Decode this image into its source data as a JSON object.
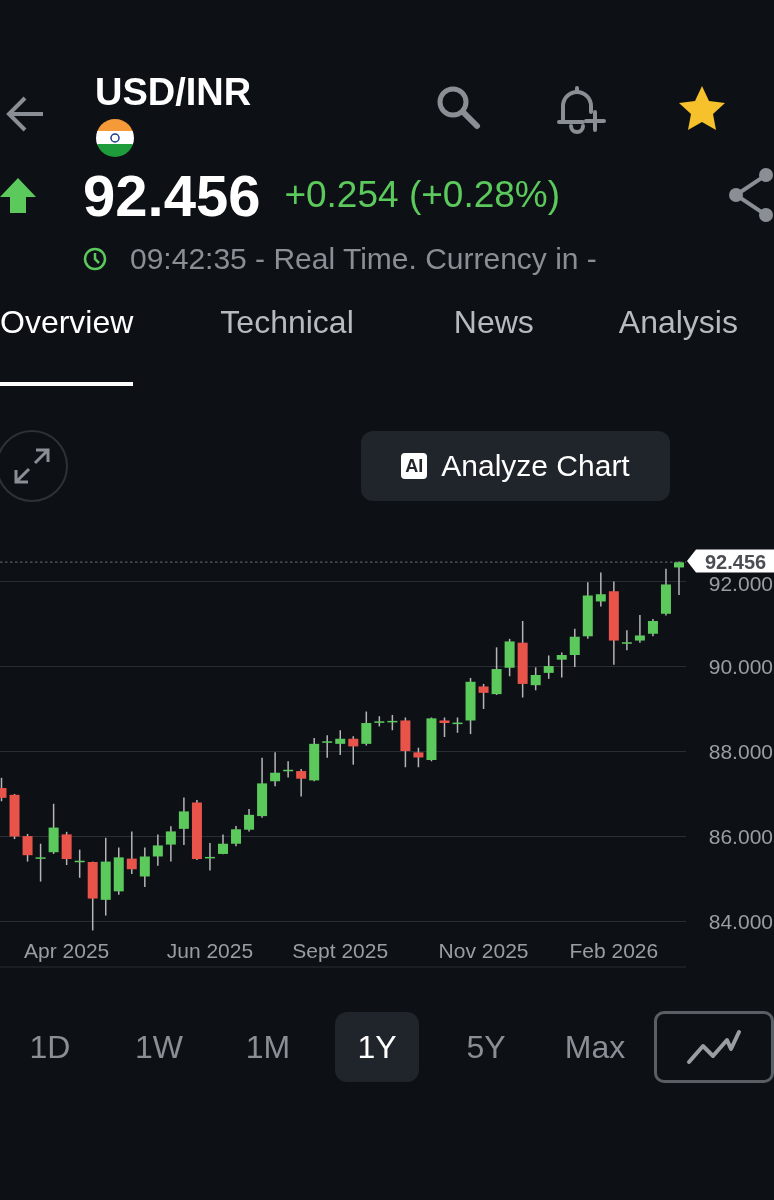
{
  "header": {
    "title": "USD/INR",
    "starred": true
  },
  "quote": {
    "price": "92.456",
    "change": "+0.254 (+0.28%)",
    "rising": true,
    "status": "09:42:35 - Real Time. Currency in -"
  },
  "tabs": [
    {
      "label": "Overview",
      "selected": true
    },
    {
      "label": "Technical",
      "selected": false
    },
    {
      "label": "News",
      "selected": false
    },
    {
      "label": "Analysis",
      "selected": false
    }
  ],
  "toolbar": {
    "ai_badge": "AI",
    "button": "Analyze Chart"
  },
  "chart": {
    "chart_data": {
      "type": "candlestick",
      "categories": [
        null,
        null,
        null,
        null,
        null,
        "Apr 2025",
        null,
        null,
        null,
        null,
        null,
        null,
        null,
        null,
        null,
        null,
        "Jun 2025",
        null,
        null,
        null,
        null,
        null,
        null,
        null,
        null,
        null,
        "Sept 2025",
        null,
        null,
        null,
        null,
        null,
        null,
        null,
        null,
        null,
        null,
        "Nov 2025",
        null,
        null,
        null,
        null,
        null,
        null,
        null,
        null,
        null,
        "Feb 2026",
        null,
        null,
        null,
        null,
        null
      ],
      "ohlc": [
        [
          87.14,
          87.38,
          86.83,
          86.91
        ],
        [
          86.98,
          87.0,
          85.94,
          86.0
        ],
        [
          86.01,
          86.06,
          85.41,
          85.56
        ],
        [
          85.48,
          85.83,
          84.94,
          85.51
        ],
        [
          85.63,
          86.77,
          85.59,
          86.21
        ],
        [
          86.05,
          86.11,
          85.33,
          85.47
        ],
        [
          85.4,
          85.69,
          85.03,
          85.43
        ],
        [
          85.4,
          85.41,
          83.79,
          84.54
        ],
        [
          84.51,
          85.97,
          84.14,
          85.41
        ],
        [
          84.71,
          85.74,
          84.63,
          85.51
        ],
        [
          85.48,
          86.12,
          85.12,
          85.23
        ],
        [
          85.06,
          85.74,
          84.81,
          85.53
        ],
        [
          85.53,
          86.05,
          85.31,
          85.79
        ],
        [
          85.81,
          86.24,
          85.41,
          86.12
        ],
        [
          86.18,
          86.92,
          85.8,
          86.59
        ],
        [
          86.8,
          86.86,
          85.45,
          85.47
        ],
        [
          85.5,
          85.85,
          85.2,
          85.52
        ],
        [
          85.59,
          86.05,
          85.58,
          85.83
        ],
        [
          85.83,
          86.25,
          85.77,
          86.17
        ],
        [
          86.16,
          86.65,
          86.12,
          86.51
        ],
        [
          86.48,
          87.85,
          86.44,
          87.25
        ],
        [
          87.3,
          87.98,
          87.18,
          87.5
        ],
        [
          87.54,
          87.77,
          87.39,
          87.57
        ],
        [
          87.54,
          87.59,
          86.94,
          87.36
        ],
        [
          87.32,
          88.32,
          87.3,
          88.18
        ],
        [
          88.21,
          88.38,
          87.85,
          88.24
        ],
        [
          88.18,
          88.5,
          87.92,
          88.3
        ],
        [
          88.3,
          88.36,
          87.69,
          88.12
        ],
        [
          88.18,
          88.94,
          88.14,
          88.67
        ],
        [
          88.68,
          88.83,
          88.59,
          88.71
        ],
        [
          88.7,
          88.86,
          88.5,
          88.72
        ],
        [
          88.73,
          88.8,
          87.63,
          88.01
        ],
        [
          87.98,
          88.09,
          87.63,
          87.86
        ],
        [
          87.8,
          88.8,
          87.77,
          88.78
        ],
        [
          88.73,
          88.8,
          88.34,
          88.67
        ],
        [
          88.66,
          88.8,
          88.44,
          88.68
        ],
        [
          88.73,
          89.73,
          88.41,
          89.64
        ],
        [
          89.53,
          89.59,
          89.0,
          89.38
        ],
        [
          89.35,
          90.45,
          89.33,
          89.94
        ],
        [
          89.97,
          90.65,
          89.77,
          90.59
        ],
        [
          90.56,
          91.07,
          89.27,
          89.59
        ],
        [
          89.56,
          89.98,
          89.44,
          89.8
        ],
        [
          89.85,
          90.26,
          89.71,
          90.01
        ],
        [
          90.16,
          90.33,
          89.74,
          90.27
        ],
        [
          90.27,
          90.89,
          89.99,
          90.7
        ],
        [
          90.71,
          91.98,
          90.65,
          91.67
        ],
        [
          91.53,
          92.21,
          91.41,
          91.7
        ],
        [
          91.77,
          92.0,
          90.04,
          90.61
        ],
        [
          90.54,
          90.85,
          90.38,
          90.57
        ],
        [
          90.61,
          91.21,
          90.56,
          90.73
        ],
        [
          90.77,
          91.12,
          90.71,
          91.07
        ],
        [
          91.24,
          92.3,
          91.2,
          91.93
        ],
        [
          92.33,
          92.47,
          91.68,
          92.45
        ]
      ],
      "ylim": [
        82.93,
        92.47
      ],
      "grid": true,
      "ref_lines": [
        {
          "label": "92.456"
        }
      ],
      "yticks": [
        {
          "value": 92,
          "label": "92.000"
        },
        {
          "value": 90,
          "label": "90.000"
        },
        {
          "value": 88,
          "label": "88.000"
        },
        {
          "value": 86,
          "label": "86.000"
        },
        {
          "value": 84,
          "label": "84.000"
        }
      ]
    }
  },
  "ranges": [
    {
      "label": "1D",
      "selected": false
    },
    {
      "label": "1W",
      "selected": false
    },
    {
      "label": "1M",
      "selected": false
    },
    {
      "label": "1Y",
      "selected": true
    },
    {
      "label": "5Y",
      "selected": false
    },
    {
      "label": "Max",
      "selected": false
    }
  ]
}
